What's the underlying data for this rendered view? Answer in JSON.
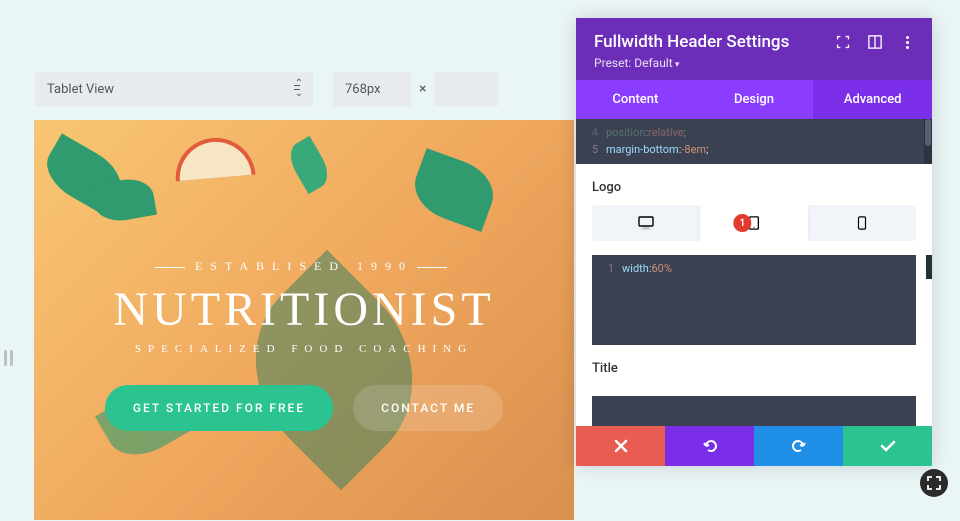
{
  "topbar": {
    "view_label": "Tablet View",
    "width_value": "768px",
    "times": "×"
  },
  "preview": {
    "established": "ESTABLISED 1990",
    "title": "NUTRITIONIST",
    "subtitle": "SPECIALIZED FOOD COACHING",
    "cta_primary": "GET STARTED FOR FREE",
    "cta_secondary": "CONTACT ME"
  },
  "panel": {
    "title": "Fullwidth Header Settings",
    "preset": "Preset: Default",
    "tabs": {
      "content": "Content",
      "design": "Design",
      "advanced": "Advanced"
    },
    "code_top": {
      "line_no": "5",
      "prop": "margin-bottom",
      "val": "-8em"
    },
    "logo_label": "Logo",
    "badge": "1",
    "code_logo": {
      "line_no": "1",
      "prop": "width",
      "val": "60%"
    },
    "title_label": "Title"
  }
}
